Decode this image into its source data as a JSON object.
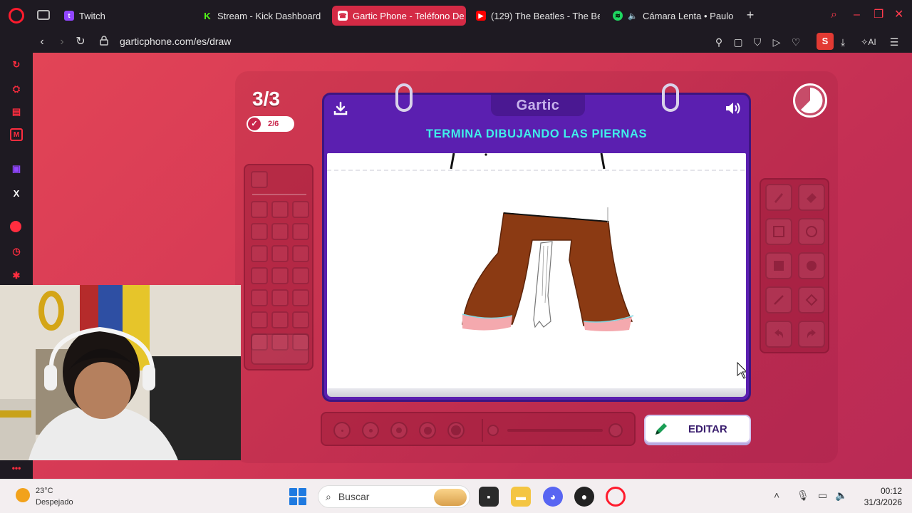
{
  "browser": {
    "tabs": [
      {
        "label": "Twitch",
        "color": "#9146ff",
        "icon": "twitch-icon"
      },
      {
        "label": "Stream - Kick Dashboard",
        "color": "#53fc18",
        "icon": "kick-icon"
      },
      {
        "label": "Gartic Phone - Teléfono De",
        "color": "#d42a45",
        "icon": "gartic-icon",
        "active": true
      },
      {
        "label": "(129) The Beatles - The Be",
        "color": "#ff0000",
        "icon": "youtube-icon"
      },
      {
        "label": "Cámara Lenta • Paulo L",
        "color": "#1ed760",
        "icon": "spotify-icon"
      }
    ],
    "url": "garticphone.com/es/draw",
    "profile_initial": "S",
    "ai_label": "AI"
  },
  "game": {
    "round": "3/3",
    "progress": "2/6",
    "logo": "Gartic",
    "instruction": "TERMINA DIBUJANDO LAS PIERNAS",
    "edit_button": "EDITAR"
  },
  "colors": {
    "accent": "#d42a45",
    "card_purple": "#5b1fb0",
    "title_cyan": "#3ff0ea",
    "pants_brown": "#8b3a13",
    "cuff_pink": "#f4a9ae"
  },
  "taskbar": {
    "weather_temp": "23°C",
    "weather_desc": "Despejado",
    "search_placeholder": "Buscar",
    "time": "00:12",
    "date": "31/3/2026"
  }
}
